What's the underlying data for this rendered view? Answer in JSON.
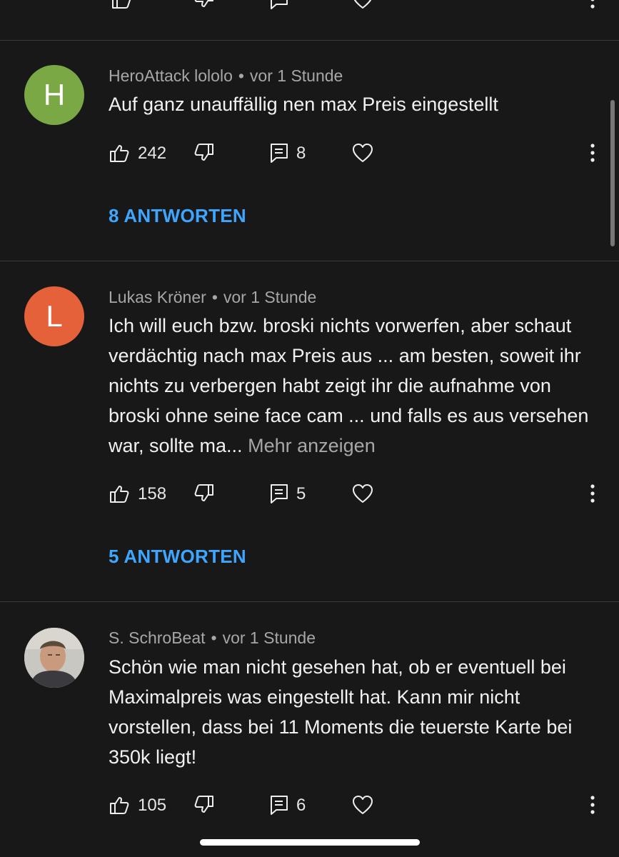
{
  "colors": {
    "background": "#181818",
    "link_blue": "#3ea6ff",
    "meta_gray": "#a7a7a7",
    "avatar_green": "#7aa845",
    "avatar_orange": "#e4613a"
  },
  "comments": [
    {
      "author": "HeroAttack lololo",
      "time": "vor 1 Stunde",
      "avatar_letter": "H",
      "text": "Auf ganz unauffällig nen max Preis eingestellt",
      "more": "",
      "likes": "242",
      "reply_count": "8",
      "replies_label": "8 ANTWORTEN"
    },
    {
      "author": "Lukas Kröner",
      "time": "vor 1 Stunde",
      "avatar_letter": "L",
      "text": "Ich will euch bzw. broski nichts vorwerfen, aber schaut verdächtig nach max Preis aus ... am besten, soweit ihr nichts zu verbergen habt zeigt ihr die aufnahme von broski ohne seine face cam ... und falls es aus versehen war, sollte ma...",
      "more": "Mehr anzeigen",
      "likes": "158",
      "reply_count": "5",
      "replies_label": "5 ANTWORTEN"
    },
    {
      "author": "S. SchroBeat",
      "time": "vor 1 Stunde",
      "avatar_letter": "",
      "text": "Schön wie man nicht gesehen hat, ob er eventuell bei Maximalpreis was eingestellt hat. Kann mir nicht vorstellen, dass bei 11 Moments die teuerste Karte bei 350k liegt!",
      "more": "",
      "likes": "105",
      "reply_count": "6",
      "replies_label": ""
    }
  ],
  "icons": {
    "like": "thumbs-up-icon",
    "dislike": "thumbs-down-icon",
    "reply": "reply-icon",
    "heart": "heart-icon",
    "more": "more-vert-icon"
  }
}
